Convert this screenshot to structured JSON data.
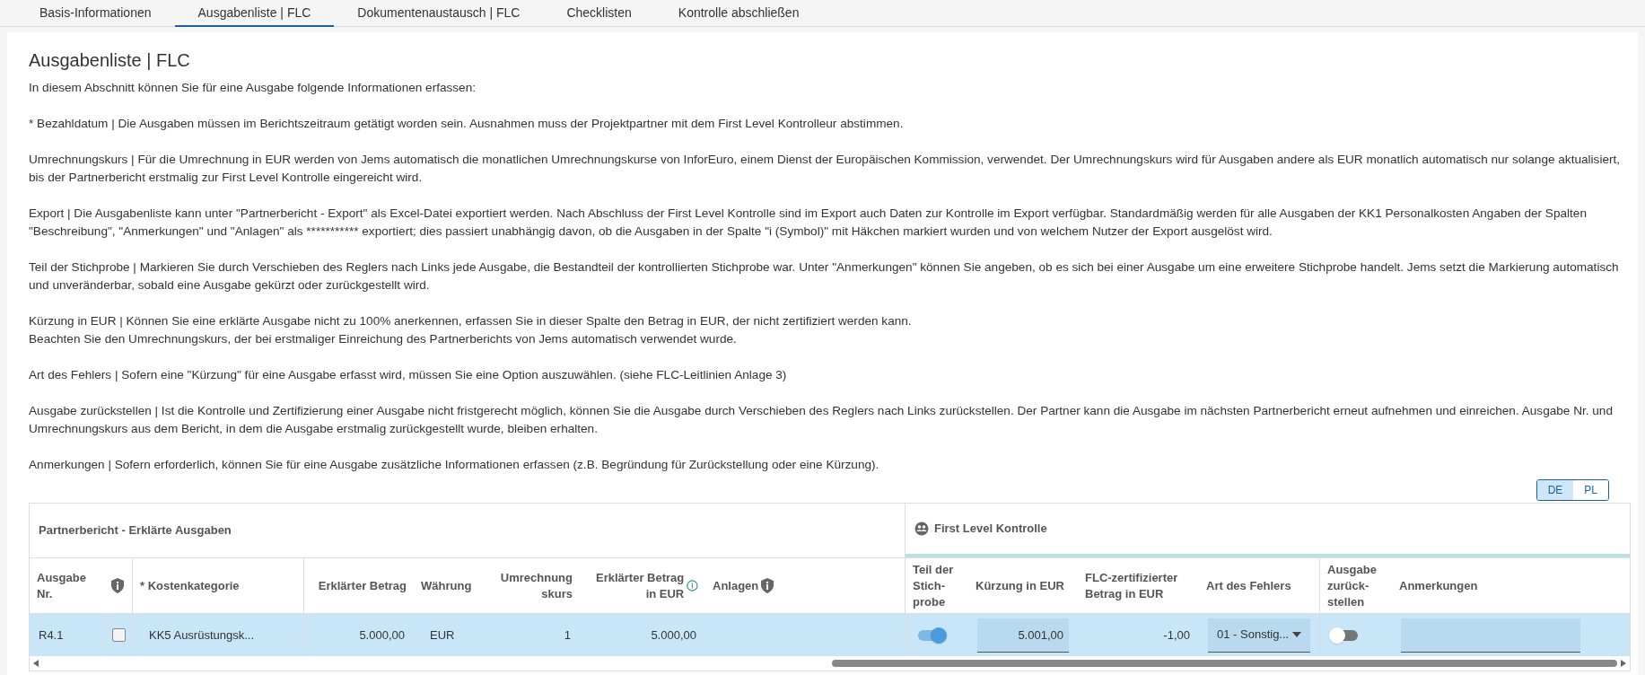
{
  "tabs": [
    {
      "label": "Basis-Informationen",
      "selected": false
    },
    {
      "label": "Ausgabenliste | FLC",
      "selected": true
    },
    {
      "label": "Dokumentenaustausch | FLC",
      "selected": false
    },
    {
      "label": "Checklisten",
      "selected": false
    },
    {
      "label": "Kontrolle abschließen",
      "selected": false
    }
  ],
  "title": "Ausgabenliste | FLC",
  "paragraphs": [
    [
      "In diesem Abschnitt können Sie für eine Ausgabe folgende Informationen erfassen:"
    ],
    [
      "* Bezahldatum | Die Ausgaben müssen im Berichtszeitraum getätigt worden sein. Ausnahmen muss der Projektpartner mit dem First Level Kontrolleur abstimmen."
    ],
    [
      "Umrechnungskurs | Für die Umrechnung in EUR werden von Jems automatisch die monatlichen Umrechnungskurse von InforEuro, einem Dienst der Europäischen Kommission, verwendet. Der Umrechnungskurs wird für Ausgaben andere als EUR monatlich automatisch nur solange aktualisiert, bis der Partnerbericht erstmalig zur First Level Kontrolle eingereicht wird."
    ],
    [
      "Export | Die Ausgabenliste kann unter \"Partnerbericht - Export\" als Excel-Datei exportiert werden. Nach Abschluss der First Level Kontrolle sind im Export auch Daten zur Kontrolle im Export verfügbar. Standardmäßig werden für alle Ausgaben der KK1 Personalkosten Angaben der Spalten \"Beschreibung\", \"Anmerkungen\" und \"Anlagen\" als *********** exportiert; dies passiert unabhängig davon, ob die Ausgaben in der Spalte \"i (Symbol)\" mit Häkchen markiert wurden und von welchem Nutzer der Export ausgelöst wird."
    ],
    [
      "Teil der Stichprobe | Markieren Sie durch Verschieben des Reglers nach Links jede Ausgabe, die Bestandteil der kontrollierten Stichprobe war. Unter \"Anmerkungen\" können Sie angeben, ob es sich bei einer Ausgabe um eine erweitere Stichprobe handelt. Jems setzt die Markierung automatisch und unveränderbar, sobald eine Ausgabe gekürzt oder zurückgestellt wird."
    ],
    [
      "Kürzung in EUR | Können Sie eine erklärte Ausgabe nicht zu 100% anerkennen, erfassen Sie in dieser Spalte den Betrag in EUR, der nicht zertifiziert werden kann.",
      "Beachten Sie den Umrechnungskurs, der bei erstmaliger Einreichung des Partnerberichts von Jems automatisch verwendet wurde."
    ],
    [
      "Art des Fehlers | Sofern eine \"Kürzung\" für eine Ausgabe erfasst wird, müssen Sie eine Option auszuwählen. (siehe FLC-Leitlinien Anlage 3)"
    ],
    [
      "Ausgabe zurückstellen | Ist die Kontrolle und Zertifizierung einer Ausgabe nicht fristgerecht möglich, können Sie die Ausgabe durch Verschieben des Reglers nach Links zurückstellen. Der Partner kann die Ausgabe im nächsten Partnerbericht erneut aufnehmen und einreichen. Ausgabe Nr. und Umrechnungskurs aus dem Bericht, in dem die Ausgabe erstmalig zurückgestellt wurde, bleiben erhalten."
    ],
    [
      "Anmerkungen | Sofern erforderlich, können Sie für eine Ausgabe zusätzliche Informationen erfassen (z.B. Begründung für Zurückstellung oder eine Kürzung)."
    ]
  ],
  "language_toggle": [
    {
      "label": "DE",
      "selected": true
    },
    {
      "label": "PL",
      "selected": false
    }
  ],
  "table": {
    "group_left": "Partnerbericht - Erklärte Ausgaben",
    "group_right": "First Level Kontrolle",
    "columns": [
      {
        "label": "Ausgabe Nr."
      },
      {},
      {
        "label": "* Kostenkategorie"
      },
      {
        "label": "Erklärter Betrag"
      },
      {
        "label": "Währung"
      },
      {
        "label": "Umrechnungskurs"
      },
      {
        "label": "Erklärter Betrag in EUR"
      },
      {
        "label": "Anlagen"
      },
      {
        "label": "Teil der Stich-probe"
      },
      {
        "label": "Kürzung in EUR"
      },
      {
        "label": "FLC-zertifizierter Betrag in EUR"
      },
      {
        "label": "Art des Fehlers"
      },
      {
        "label": "Ausgabe zurück-stellen"
      },
      {
        "label": "Anmerkungen"
      }
    ],
    "rows": [
      {
        "number": "R4.1",
        "checked": false,
        "category": "KK5 Ausrüstungsk...",
        "amount": "5.000,00",
        "currency": "EUR",
        "rate": "1",
        "amount_eur": "5.000,00",
        "sample": true,
        "reduction": "5.001,00",
        "certified": "-1,00",
        "error_type": "01 - Sonstig...",
        "deferred": false
      }
    ]
  }
}
